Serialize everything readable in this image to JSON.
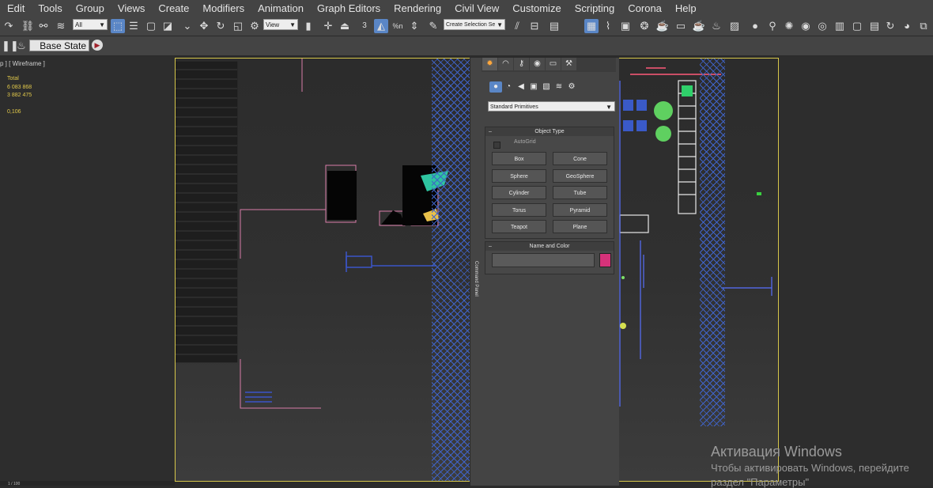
{
  "menu": [
    "Edit",
    "Tools",
    "Group",
    "Views",
    "Create",
    "Modifiers",
    "Animation",
    "Graph Editors",
    "Rendering",
    "Civil View",
    "Customize",
    "Scripting",
    "Corona",
    "Help"
  ],
  "toolbar": {
    "filter_value": "All",
    "coord_value": "View",
    "selection_set_placeholder": "Create Selection Se",
    "spinner_3": "3",
    "percent_n": "%n"
  },
  "toolbar2": {
    "state_label": "Base State"
  },
  "viewport": {
    "label": "p ] [ Wireframe ]",
    "stats_total": "Total",
    "stats_polys": "6 083 868",
    "stats_verts": "3 882 475",
    "stats_fps": "0,106"
  },
  "command_panel": {
    "vertical_label": "Command Panel",
    "dropdown": "Standard Primitives",
    "object_type_title": "Object Type",
    "autogrid_label": "AutoGrid",
    "buttons": [
      "Box",
      "Cone",
      "Sphere",
      "GeoSphere",
      "Cylinder",
      "Tube",
      "Torus",
      "Pyramid",
      "Teapot",
      "Plane"
    ],
    "name_color_title": "Name and Color",
    "swatch_color": "#d6327a"
  },
  "watermark": {
    "line1": "Активация Windows",
    "line2": "Чтобы активировать Windows, перейдите",
    "line3": "раздел \"Параметры\""
  },
  "status": {
    "text": "1 / 100"
  },
  "icons": [
    "undo-icon",
    "link-icon",
    "unlink-icon",
    "bind-space-warp-icon",
    "select-object-icon",
    "select-by-name-icon",
    "rect-region-icon",
    "window-crossing-icon",
    "move-icon",
    "rotate-icon",
    "scale-icon",
    "pivot-icon",
    "snaps-icon",
    "angle-snap-icon",
    "percent-snap-icon",
    "spinner-snap-icon",
    "mirror-icon",
    "align-icon",
    "layers-icon",
    "curve-editor-icon",
    "schematic-icon",
    "material-editor-icon",
    "render-setup-icon",
    "render-frame-icon",
    "render-icon",
    "teapot-icon",
    "camera-icon",
    "light-icon",
    "corona-icon"
  ]
}
